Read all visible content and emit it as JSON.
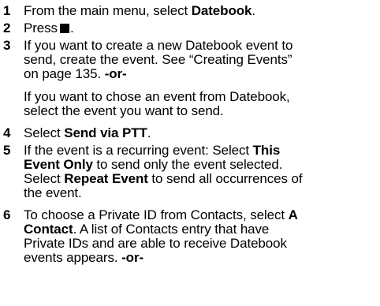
{
  "steps": [
    {
      "number": "1",
      "lines": [
        {
          "text": "From the main menu, select ",
          "bold": "Datebook",
          "after": "."
        }
      ]
    },
    {
      "number": "2",
      "lines": [
        {
          "text": "Press",
          "key_icon": "menu-key-icon",
          "after": "."
        }
      ]
    },
    {
      "number": "3",
      "lines": [
        {
          "text": "If you want to create a new Datebook event to"
        },
        {
          "text": "send, create the event. See “Creating Events”"
        },
        {
          "text": "on page 135. ",
          "bold": "-or-"
        },
        {
          "text": "If you want to chose an event from Datebook,"
        },
        {
          "text": "select the event you want to send."
        }
      ]
    },
    {
      "number": "4",
      "lines": [
        {
          "text": "Select ",
          "bold": "Send via PTT",
          "after": "."
        }
      ]
    },
    {
      "number": "5",
      "lines": [
        {
          "text": "If the event is a recurring event: Select ",
          "bold": "This"
        },
        {
          "bold_first": "Event Only",
          "text": " to send only the event selected."
        },
        {
          "text": "Select ",
          "bold": "Repeat Event",
          "after": " to send all occurrences of"
        },
        {
          "text": "the event."
        }
      ]
    },
    {
      "number": "6",
      "lines": [
        {
          "text": "To choose a Private ID from Contacts, select ",
          "bold": "A"
        },
        {
          "bold_first": "Contact",
          "text": ". A list of Contacts entry that have"
        },
        {
          "text": "Private IDs and are able to receive Datebook"
        },
        {
          "text": "events appears. ",
          "bold": "-or-"
        }
      ]
    }
  ]
}
